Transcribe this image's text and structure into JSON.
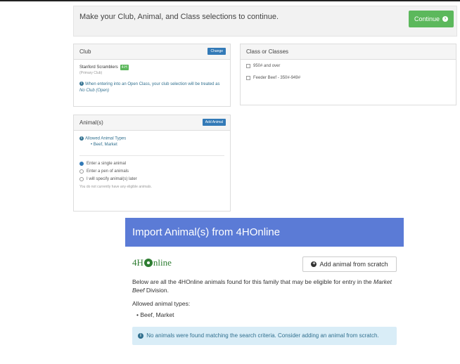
{
  "banner": {
    "message": "Make your Club, Animal, and Class selections to continue.",
    "continue_label": "Continue",
    "continue_icon": "›"
  },
  "club": {
    "title": "Club",
    "change_label": "Change",
    "club_name": "Stanford Scramblers",
    "club_badge": "4-H",
    "club_sub": "(Primary Club)",
    "note_prefix": "When entering into an Open Class, your club selection will be treated as ",
    "note_emph": "No Club (Open)",
    "info_glyph": "i"
  },
  "animals": {
    "title": "Animal(s)",
    "add_label": "Add Animal",
    "allowed_title": "Allowed Animal Types",
    "allowed_items": [
      "Beef, Market"
    ],
    "options": [
      {
        "label": "Enter a single animal",
        "selected": true
      },
      {
        "label": "Enter a pen of animals",
        "selected": false
      },
      {
        "label": "I will specify animal(s) later",
        "selected": false
      }
    ],
    "none_note": "You do not currently have any eligible animals.",
    "bullet": "•"
  },
  "classes": {
    "title": "Class or Classes",
    "items": [
      "950# and over",
      "Feeder Beef - 350#-949#"
    ]
  },
  "modal": {
    "title": "Import Animal(s) from 4HOnline",
    "logo_left": "4H",
    "logo_right": "nline",
    "add_scratch_label": "Add animal from scratch",
    "add_scratch_icon": "+",
    "desc_prefix": "Below are all the 4HOnline animals found for this family that may be eligible for entry in the ",
    "desc_emph": "Market Beef",
    "desc_suffix": " Division.",
    "allowed_label": "Allowed animal types:",
    "allowed_items": [
      "Beef, Market"
    ],
    "bullet": "•",
    "alert_text": "No animals were found matching the search criteria. Consider adding an animal from scratch.",
    "info_glyph": "i"
  },
  "colors": {
    "continue_green": "#5cb85c",
    "modal_header_blue": "#5b7bd6",
    "info_text": "#31708f",
    "alert_bg": "#d9edf7",
    "primary_btn": "#337ab7"
  }
}
